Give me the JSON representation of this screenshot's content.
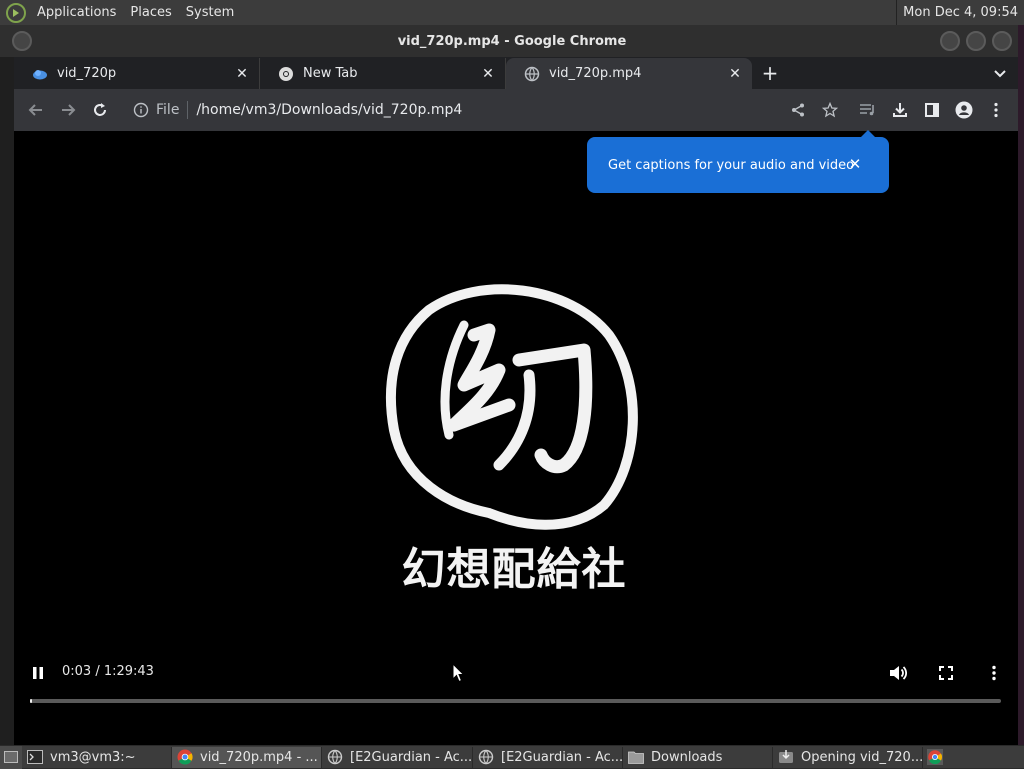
{
  "top_panel": {
    "menus": [
      "Applications",
      "Places",
      "System"
    ],
    "clock": "Mon Dec  4, 09:54"
  },
  "window": {
    "title": "vid_720p.mp4 - Google Chrome"
  },
  "tabs": [
    {
      "label": "vid_720p",
      "icon": "cloud-favicon-icon",
      "active": false
    },
    {
      "label": "New Tab",
      "icon": "chrome-favicon-icon",
      "active": false
    },
    {
      "label": "vid_720p.mp4",
      "icon": "globe-favicon-icon",
      "active": true
    }
  ],
  "omnibox": {
    "scheme": "File",
    "url": "/home/vm3/Downloads/vid_720p.mp4"
  },
  "caption_bubble": {
    "text": "Get captions for your audio and video"
  },
  "video": {
    "studio_name": "幻想配給社",
    "current_time": "0:03",
    "duration": "1:29:43",
    "time_display": "0:03 / 1:29:43",
    "progress_fraction": 0.0006,
    "state": "playing"
  },
  "taskbar": {
    "items": [
      {
        "label": "vm3@vm3:~",
        "icon": "terminal-icon",
        "active": false
      },
      {
        "label": "vid_720p.mp4 - ...",
        "icon": "chrome-icon",
        "active": true
      },
      {
        "label": "[E2Guardian - Ac...",
        "icon": "globe-icon",
        "active": false
      },
      {
        "label": "[E2Guardian - Ac...",
        "icon": "globe-icon",
        "active": false
      },
      {
        "label": "Downloads",
        "icon": "folder-icon",
        "active": false
      },
      {
        "label": "Opening vid_720...",
        "icon": "download-dialog-icon",
        "active": false
      }
    ]
  },
  "colors": {
    "accent_blue": "#1a6fd6",
    "tab_active": "#35363a",
    "tab_inactive": "#202124"
  }
}
